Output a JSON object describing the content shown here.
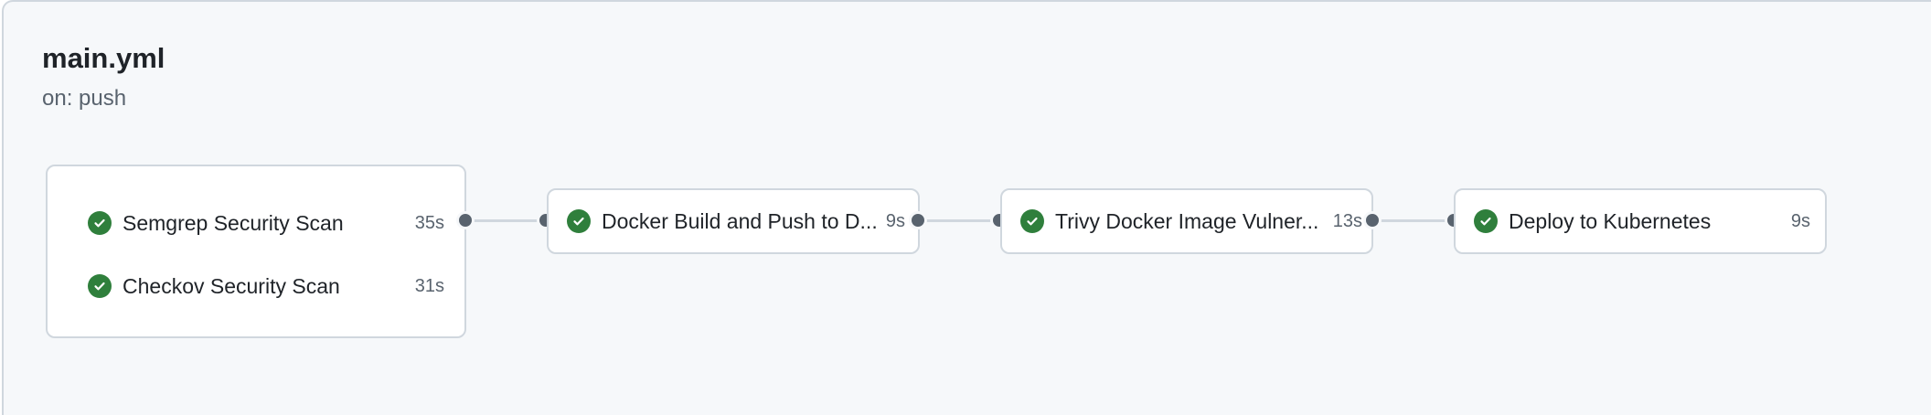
{
  "workflow": {
    "title": "main.yml",
    "trigger": "on: push"
  },
  "jobs": [
    {
      "name": "Semgrep Security Scan",
      "duration": "35s",
      "status": "success"
    },
    {
      "name": "Checkov Security Scan",
      "duration": "31s",
      "status": "success"
    },
    {
      "name": "Docker Build and Push to D...",
      "duration": "9s",
      "status": "success"
    },
    {
      "name": "Trivy Docker Image Vulner...",
      "duration": "13s",
      "status": "success"
    },
    {
      "name": "Deploy to Kubernetes",
      "duration": "9s",
      "status": "success"
    }
  ],
  "colors": {
    "success": "#2f7f3c",
    "connector": "#d0d7de",
    "node": "#59636e"
  },
  "icons": {
    "status": "check-circle-icon"
  }
}
